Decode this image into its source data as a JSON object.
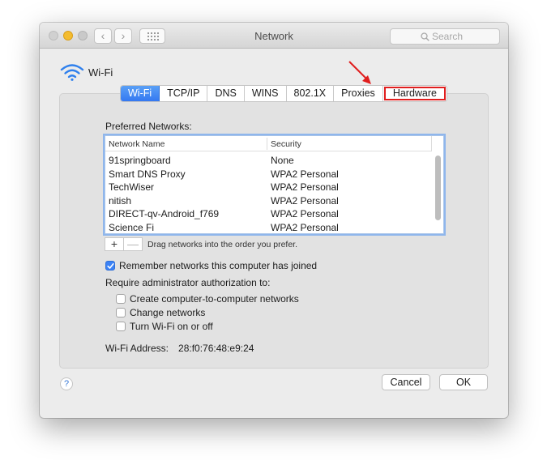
{
  "window": {
    "title": "Network"
  },
  "search": {
    "placeholder": "Search"
  },
  "wifi": {
    "label": "Wi-Fi"
  },
  "tabs": [
    {
      "label": "Wi-Fi",
      "active": true
    },
    {
      "label": "TCP/IP"
    },
    {
      "label": "DNS"
    },
    {
      "label": "WINS"
    },
    {
      "label": "802.1X"
    },
    {
      "label": "Proxies"
    },
    {
      "label": "Hardware",
      "highlighted": true
    }
  ],
  "preferred": {
    "label": "Preferred Networks:",
    "columns": [
      "Network Name",
      "Security"
    ],
    "rows": [
      [
        "91springboard",
        "None"
      ],
      [
        "Smart DNS Proxy",
        "WPA2 Personal"
      ],
      [
        "TechWiser",
        "WPA2 Personal"
      ],
      [
        "nitish",
        "WPA2 Personal"
      ],
      [
        "DIRECT-qv-Android_f769",
        "WPA2 Personal"
      ],
      [
        "Science Fi",
        "WPA2 Personal"
      ]
    ],
    "add": "+",
    "remove": "—",
    "drag_hint": "Drag networks into the order you prefer."
  },
  "remember": {
    "label": "Remember networks this computer has joined",
    "checked": true
  },
  "admin": {
    "label": "Require administrator authorization to:",
    "options": [
      {
        "label": "Create computer-to-computer networks",
        "checked": false
      },
      {
        "label": "Change networks",
        "checked": false
      },
      {
        "label": "Turn Wi-Fi on or off",
        "checked": false
      }
    ]
  },
  "address": {
    "label": "Wi-Fi Address:",
    "value": "28:f0:76:48:e9:24"
  },
  "help": "?",
  "buttons": {
    "cancel": "Cancel",
    "ok": "OK"
  },
  "colors": {
    "accent": "#3478f1",
    "annotation": "#e01e1e"
  },
  "icons": [
    "wifi-icon",
    "search-icon",
    "grid-icon",
    "back-chevron-icon",
    "forward-chevron-icon",
    "annotation-arrow-icon"
  ]
}
